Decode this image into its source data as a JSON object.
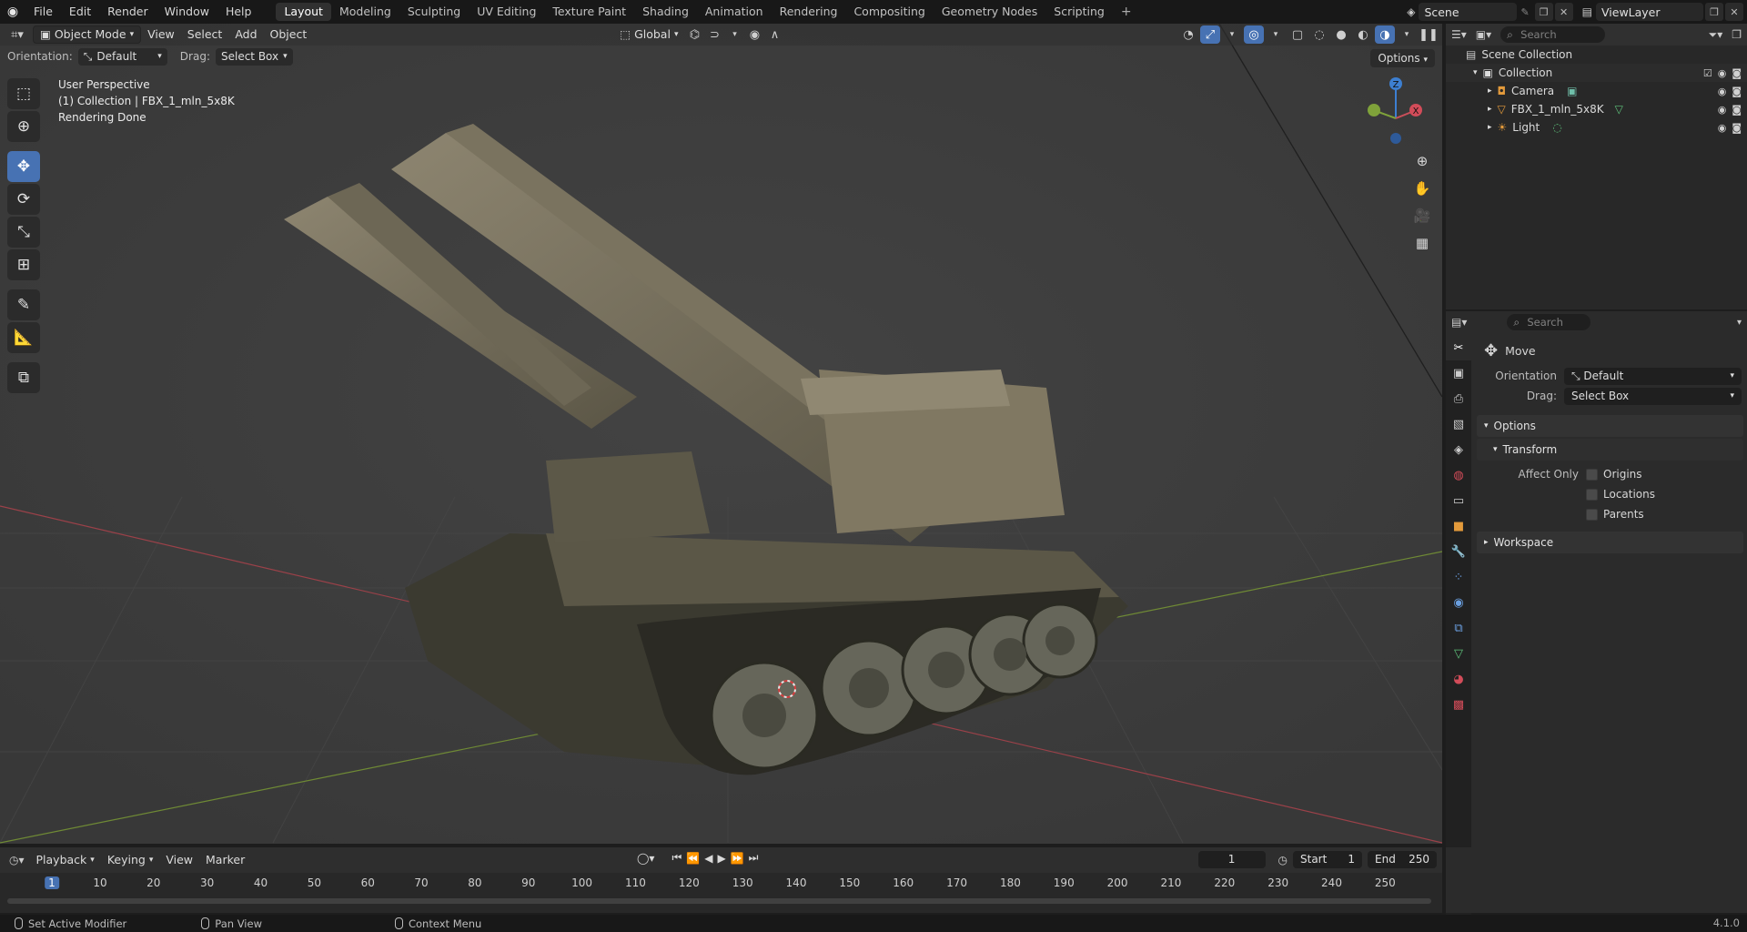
{
  "topbar": {
    "menus": [
      "File",
      "Edit",
      "Render",
      "Window",
      "Help"
    ],
    "workspaces": [
      "Layout",
      "Modeling",
      "Sculpting",
      "UV Editing",
      "Texture Paint",
      "Shading",
      "Animation",
      "Rendering",
      "Compositing",
      "Geometry Nodes",
      "Scripting"
    ],
    "active_workspace": "Layout",
    "add_workspace": "+",
    "scene": "Scene",
    "view_layer": "ViewLayer"
  },
  "viewport": {
    "mode": "Object Mode",
    "menus": [
      "View",
      "Select",
      "Add",
      "Object"
    ],
    "transform_orientation": "Global",
    "orientation_label": "Orientation:",
    "orientation_value": "Default",
    "drag_label": "Drag:",
    "drag_value": "Select Box",
    "options": "Options",
    "overlay_lines": [
      "User Perspective",
      "(1) Collection | FBX_1_mln_5x8K",
      "Rendering Done"
    ],
    "gizmo": {
      "z": "Z",
      "x": "X"
    }
  },
  "outliner": {
    "search_placeholder": "Search",
    "root": "Scene Collection",
    "collection": "Collection",
    "items": [
      "Camera",
      "FBX_1_mln_5x8K",
      "Light"
    ]
  },
  "properties": {
    "search_placeholder": "Search",
    "tool_name": "Move",
    "orientation_label": "Orientation",
    "orientation_value": "Default",
    "drag_label": "Drag:",
    "drag_value": "Select Box",
    "options_section": "Options",
    "transform_section": "Transform",
    "affect_only": "Affect Only",
    "checks": [
      "Origins",
      "Locations",
      "Parents"
    ],
    "workspace_section": "Workspace"
  },
  "timeline": {
    "menus": [
      "Playback",
      "Keying",
      "View",
      "Marker"
    ],
    "current_frame": "1",
    "start_label": "Start",
    "start_value": "1",
    "end_label": "End",
    "end_value": "250",
    "ruler": [
      "1",
      "10",
      "20",
      "30",
      "40",
      "50",
      "60",
      "70",
      "80",
      "90",
      "100",
      "110",
      "120",
      "130",
      "140",
      "150",
      "160",
      "170",
      "180",
      "190",
      "200",
      "210",
      "220",
      "230",
      "240",
      "250"
    ]
  },
  "statusbar": {
    "left": "Set Active Modifier",
    "middle": "Pan View",
    "right": "Context Menu",
    "version": "4.1.0"
  },
  "colors": {
    "accent": "#4772b3",
    "viewport_bg": "#3d3d3d",
    "axis_x": "#c94f5a",
    "axis_y": "#7fa23a",
    "axis_z": "#3d7fd1"
  }
}
